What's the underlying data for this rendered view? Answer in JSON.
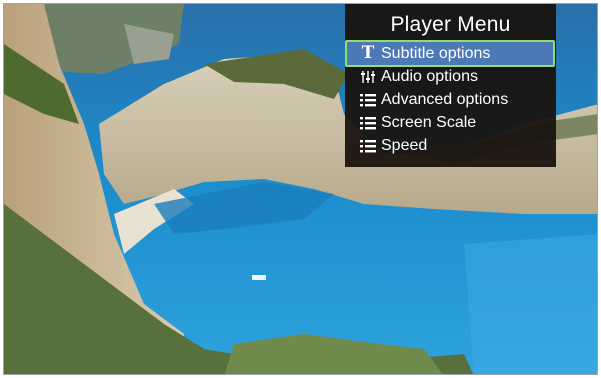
{
  "menu": {
    "title": "Player Menu",
    "items": [
      {
        "label": "Subtitle options",
        "icon": "subtitle-T-icon",
        "selected": true
      },
      {
        "label": "Audio options",
        "icon": "equalizer-sliders-icon",
        "selected": false
      },
      {
        "label": "Advanced options",
        "icon": "list-icon",
        "selected": false
      },
      {
        "label": "Screen Scale",
        "icon": "list-icon",
        "selected": false
      },
      {
        "label": "Speed",
        "icon": "list-icon",
        "selected": false
      }
    ],
    "colors": {
      "panel": "#18120e",
      "selection": "#4d79b6",
      "selection_border": "#8fdf6f",
      "text": "#ffffff"
    }
  },
  "background": {
    "description_colors": {
      "sea": "#1d8fc9",
      "cliff": "#c8bfa8",
      "vegetation": "#556b3a",
      "sky_sea_top": "#2f6fa8"
    }
  }
}
